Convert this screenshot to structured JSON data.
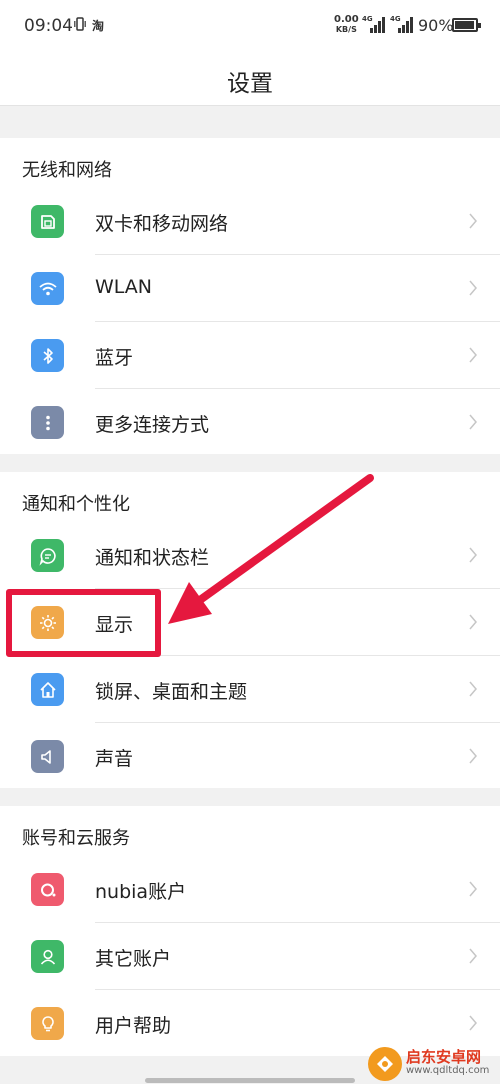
{
  "status_bar": {
    "time": "09:04",
    "app_glyph": "淘",
    "net_speed_value": "0.00",
    "net_speed_unit": "KB/S",
    "sim1_tag": "4G",
    "sim2_tag": "4G",
    "battery": "90%"
  },
  "header": {
    "title": "设置"
  },
  "sections": [
    {
      "title": "无线和网络",
      "items": [
        {
          "label": "双卡和移动网络",
          "icon": "sim-card-icon",
          "color": "#3fb868"
        },
        {
          "label": "WLAN",
          "icon": "wifi-icon",
          "color": "#4a9bf0"
        },
        {
          "label": "蓝牙",
          "icon": "bluetooth-icon",
          "color": "#4a9bf0"
        },
        {
          "label": "更多连接方式",
          "icon": "more-icon",
          "color": "#7b8aa8"
        }
      ]
    },
    {
      "title": "通知和个性化",
      "items": [
        {
          "label": "通知和状态栏",
          "icon": "chat-bubble-icon",
          "color": "#3fb868"
        },
        {
          "label": "显示",
          "icon": "brightness-icon",
          "color": "#f0a84a"
        },
        {
          "label": "锁屏、桌面和主题",
          "icon": "home-icon",
          "color": "#4a9bf0"
        },
        {
          "label": "声音",
          "icon": "speaker-icon",
          "color": "#7b8aa8"
        }
      ]
    },
    {
      "title": "账号和云服务",
      "items": [
        {
          "label": "nubia账户",
          "icon": "nubia-icon",
          "color": "#ef5a6e"
        },
        {
          "label": "其它账户",
          "icon": "user-icon",
          "color": "#3fb868"
        },
        {
          "label": "用户帮助",
          "icon": "lightbulb-icon",
          "color": "#f0a84a"
        }
      ]
    }
  ],
  "annotation": {
    "highlight_color": "#e5183e"
  },
  "watermark": {
    "name": "启东安卓网",
    "url": "www.qdltdq.com"
  }
}
